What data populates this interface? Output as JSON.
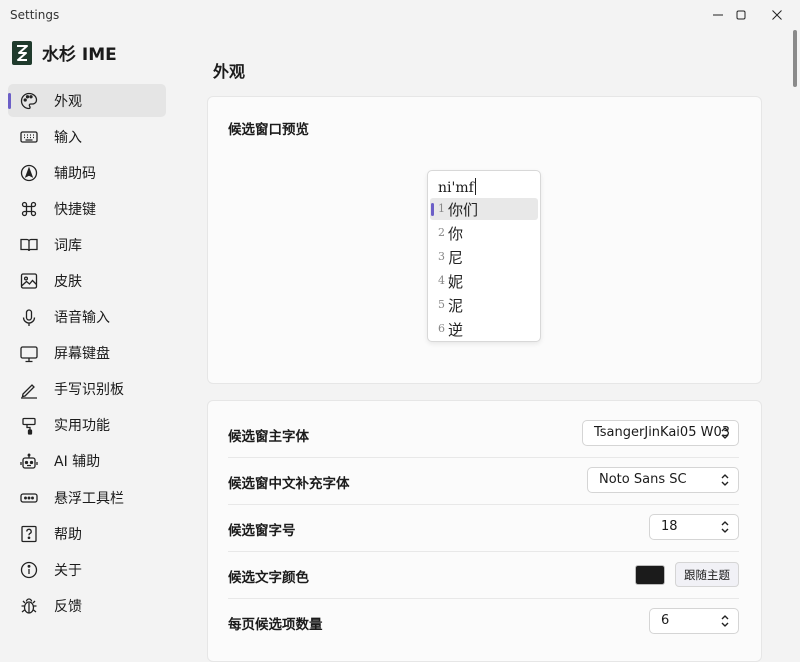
{
  "window": {
    "title": "Settings"
  },
  "app": {
    "name": "水杉 IME"
  },
  "sidebar": {
    "items": [
      {
        "label": "外观",
        "icon": "palette-icon",
        "selected": true
      },
      {
        "label": "输入",
        "icon": "keyboard-icon"
      },
      {
        "label": "辅助码",
        "icon": "compass-icon"
      },
      {
        "label": "快捷键",
        "icon": "command-icon"
      },
      {
        "label": "词库",
        "icon": "book-icon"
      },
      {
        "label": "皮肤",
        "icon": "image-icon"
      },
      {
        "label": "语音输入",
        "icon": "microphone-icon"
      },
      {
        "label": "屏幕键盘",
        "icon": "monitor-icon"
      },
      {
        "label": "手写识别板",
        "icon": "pen-icon"
      },
      {
        "label": "实用功能",
        "icon": "paint-roller-icon"
      },
      {
        "label": "AI 辅助",
        "icon": "robot-icon"
      },
      {
        "label": "悬浮工具栏",
        "icon": "toolbar-icon"
      },
      {
        "label": "帮助",
        "icon": "help-icon"
      },
      {
        "label": "关于",
        "icon": "info-icon"
      },
      {
        "label": "反馈",
        "icon": "bug-icon"
      }
    ]
  },
  "page": {
    "title": "外观"
  },
  "preview": {
    "label": "候选窗口预览",
    "preedit": "ni'mf",
    "candidates": [
      {
        "index": "1",
        "text": "你们",
        "highlighted": true
      },
      {
        "index": "2",
        "text": "你"
      },
      {
        "index": "3",
        "text": "尼"
      },
      {
        "index": "4",
        "text": "妮"
      },
      {
        "index": "5",
        "text": "泥"
      },
      {
        "index": "6",
        "text": "逆"
      }
    ]
  },
  "settings": {
    "main_font": {
      "label": "候选窗主字体",
      "value": "TsangerJinKai05 W03"
    },
    "cjk_font": {
      "label": "候选窗中文补充字体",
      "value": "Noto Sans SC"
    },
    "font_size": {
      "label": "候选窗字号",
      "value": "18"
    },
    "text_color": {
      "label": "候选文字颜色",
      "color": "#1b1b1b",
      "button_label": "跟随主题"
    },
    "page_size": {
      "label": "每页候选项数量",
      "value": "6"
    }
  },
  "colors": {
    "accent": "#6c5fc7",
    "background": "#f3f3f3",
    "card": "#fbfbfb"
  }
}
